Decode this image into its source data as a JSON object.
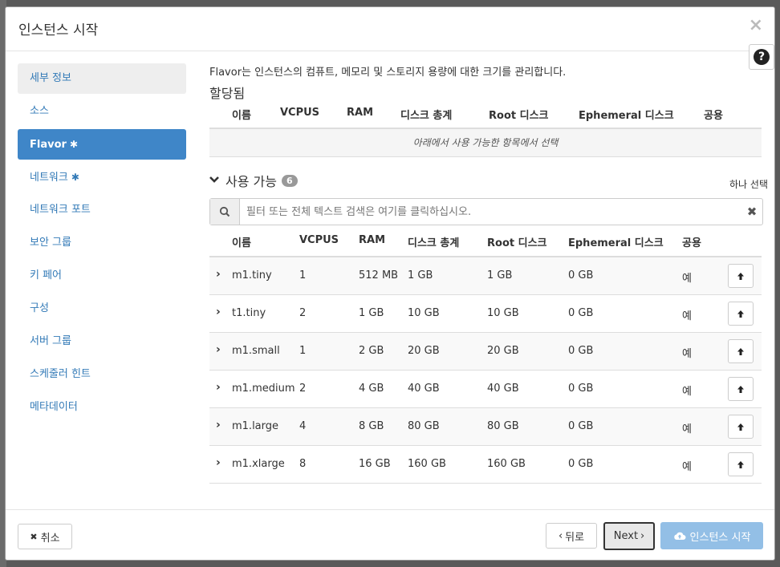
{
  "modal": {
    "title": "인스턴스 시작",
    "close_glyph": "×",
    "help_glyph": "?"
  },
  "sidebar": {
    "items": [
      {
        "label": "세부 정보",
        "required": false
      },
      {
        "label": "소스",
        "required": false
      },
      {
        "label": "Flavor",
        "required": true
      },
      {
        "label": "네트워크",
        "required": true
      },
      {
        "label": "네트워크 포트",
        "required": false
      },
      {
        "label": "보안 그룹",
        "required": false
      },
      {
        "label": "키 페어",
        "required": false
      },
      {
        "label": "구성",
        "required": false
      },
      {
        "label": "서버 그룹",
        "required": false
      },
      {
        "label": "스케줄러 힌트",
        "required": false
      },
      {
        "label": "메타데이터",
        "required": false
      }
    ],
    "required_glyph": "✱"
  },
  "main": {
    "description": "Flavor는 인스턴스의 컴퓨트, 메모리 및 스토리지 용량에 대한 크기를 관리합니다.",
    "allocated": {
      "title": "할당됨",
      "columns": [
        "이름",
        "VCPUS",
        "RAM",
        "디스크 총계",
        "Root 디스크",
        "Ephemeral 디스크",
        "공용"
      ],
      "empty_text": "아래에서 사용 가능한 항목에서 선택"
    },
    "available": {
      "title": "사용 가능",
      "count": "6",
      "select_hint": "하나 선택",
      "search_placeholder": "필터 또는 전체 텍스트 검색은 여기를 클릭하십시오.",
      "columns": [
        "이름",
        "VCPUS",
        "RAM",
        "디스크 총계",
        "Root 디스크",
        "Ephemeral 디스크",
        "공용"
      ],
      "rows": [
        {
          "name": "m1.tiny",
          "vcpus": "1",
          "ram": "512 MB",
          "disk_total": "1 GB",
          "root": "1 GB",
          "ephemeral": "0 GB",
          "public": "예"
        },
        {
          "name": "t1.tiny",
          "vcpus": "2",
          "ram": "1 GB",
          "disk_total": "10 GB",
          "root": "10 GB",
          "ephemeral": "0 GB",
          "public": "예"
        },
        {
          "name": "m1.small",
          "vcpus": "1",
          "ram": "2 GB",
          "disk_total": "20 GB",
          "root": "20 GB",
          "ephemeral": "0 GB",
          "public": "예"
        },
        {
          "name": "m1.medium",
          "vcpus": "2",
          "ram": "4 GB",
          "disk_total": "40 GB",
          "root": "40 GB",
          "ephemeral": "0 GB",
          "public": "예"
        },
        {
          "name": "m1.large",
          "vcpus": "4",
          "ram": "8 GB",
          "disk_total": "80 GB",
          "root": "80 GB",
          "ephemeral": "0 GB",
          "public": "예"
        },
        {
          "name": "m1.xlarge",
          "vcpus": "8",
          "ram": "16 GB",
          "disk_total": "160 GB",
          "root": "160 GB",
          "ephemeral": "0 GB",
          "public": "예"
        }
      ]
    }
  },
  "footer": {
    "cancel_label": "취소",
    "back_label": "뒤로",
    "next_label": "Next",
    "launch_label": "인스턴스 시작"
  },
  "colors": {
    "active_nav": "#3f86c8",
    "link": "#337ab7",
    "launch_button": "#93bfe6"
  }
}
